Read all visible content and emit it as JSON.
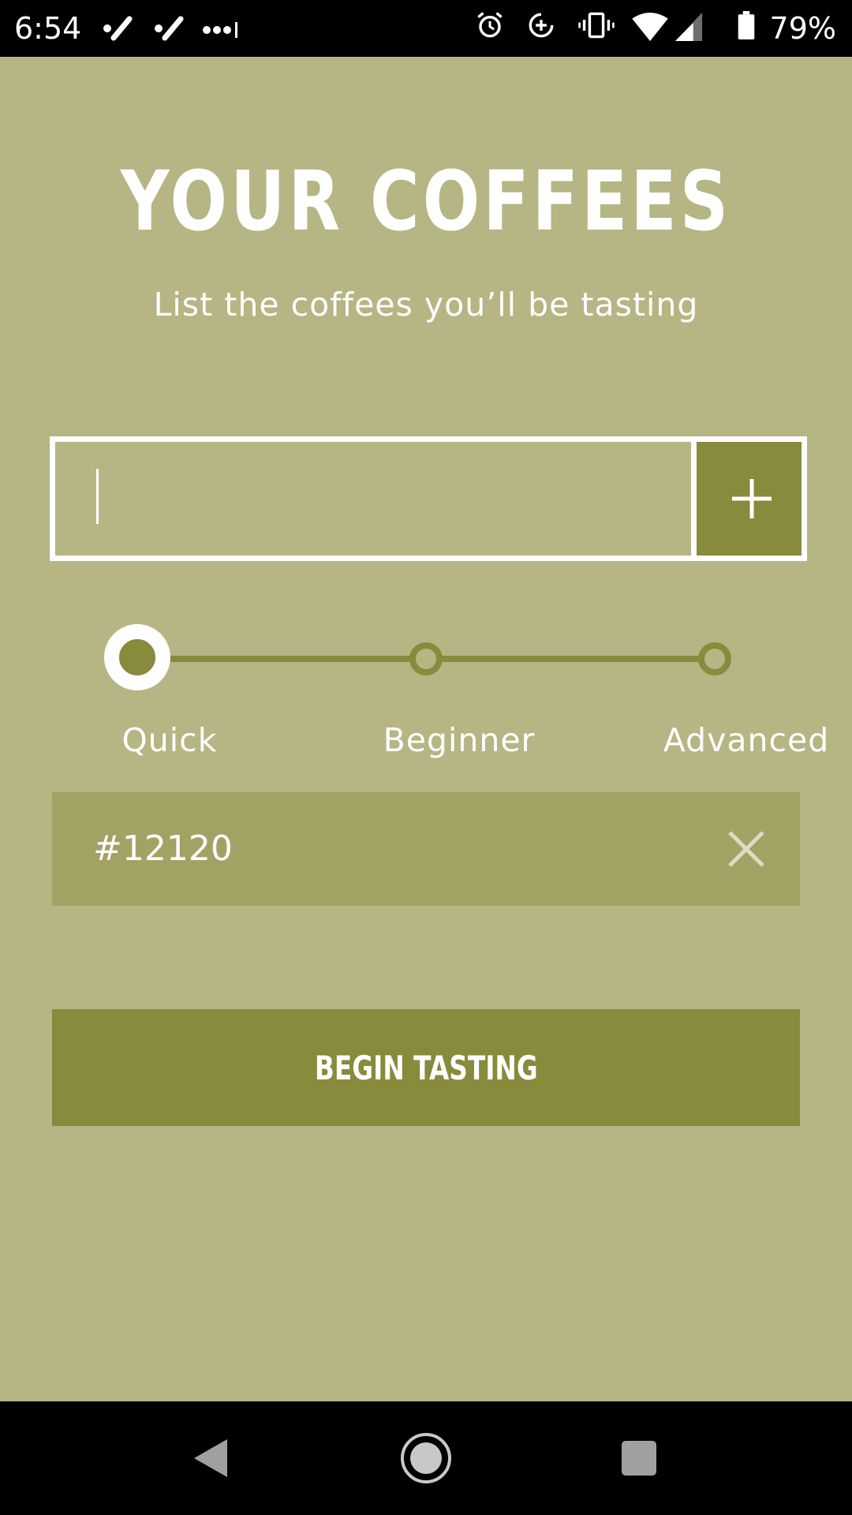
{
  "status_bar": {
    "time": "6:54",
    "battery_percent": "79%",
    "icons": [
      "check-icon",
      "check-icon",
      "more-notifications-icon",
      "alarm-icon",
      "data-saver-icon",
      "vibrate-icon",
      "wifi-icon",
      "signal-icon",
      "battery-icon"
    ]
  },
  "header": {
    "title": "YOUR COFFEES",
    "subtitle": "List the coffees you’ll be tasting"
  },
  "coffee_input": {
    "value": "",
    "placeholder": "",
    "add_button_icon": "plus-icon"
  },
  "level_slider": {
    "selected": "Quick",
    "levels": [
      {
        "label": "Quick"
      },
      {
        "label": "Beginner"
      },
      {
        "label": "Advanced"
      }
    ]
  },
  "coffees": [
    {
      "name": "#12120",
      "remove_icon": "close-icon"
    }
  ],
  "begin_button": {
    "label": "BEGIN TASTING"
  },
  "nav_bar": {
    "icons": [
      "back-icon",
      "home-icon",
      "recents-icon"
    ]
  },
  "colors": {
    "background": "#b6b584",
    "accent": "#888a3c",
    "list_item": "#a3a265",
    "text": "#ffffff"
  }
}
